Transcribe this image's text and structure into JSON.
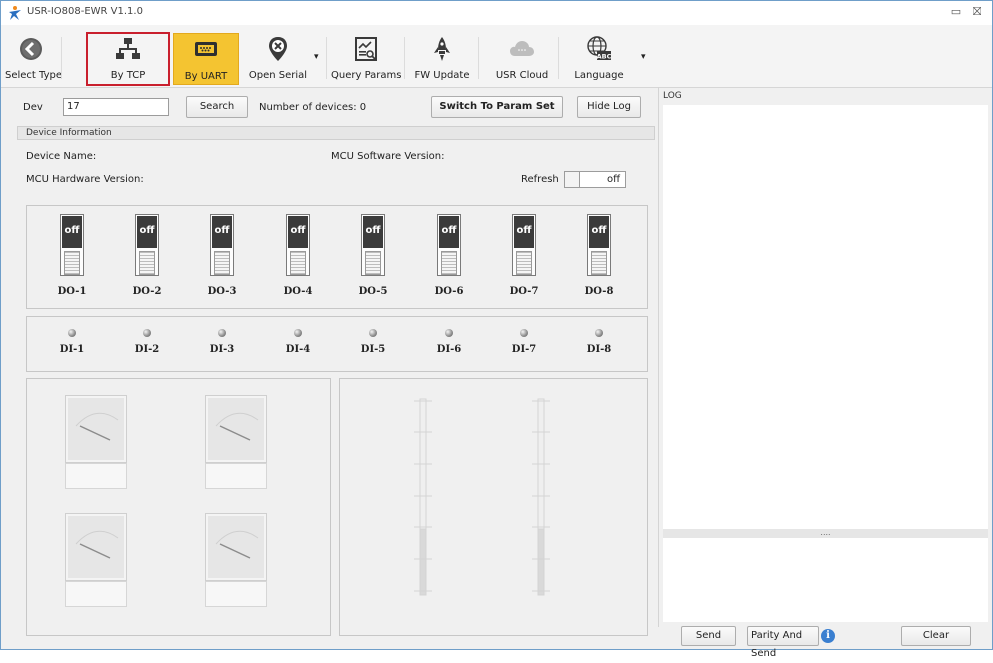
{
  "window": {
    "title": "USR-IO808-EWR V1.1.0",
    "minimize": "▭",
    "close": "⛝"
  },
  "toolbar": {
    "items": [
      {
        "label": "Select Type",
        "icon": "back-arrow-icon"
      },
      {
        "label": "By TCP",
        "icon": "network-icon"
      },
      {
        "label": "By UART",
        "icon": "serial-port-icon"
      },
      {
        "label": "Open Serial",
        "icon": "close-circle-pin-icon"
      },
      {
        "label": "Query Params",
        "icon": "query-params-icon"
      },
      {
        "label": "FW Update",
        "icon": "rocket-icon"
      },
      {
        "label": "USR Cloud",
        "icon": "cloud-icon"
      },
      {
        "label": "Language",
        "icon": "globe-abc-icon"
      }
    ],
    "active_item": "By UART",
    "highlighted_item": "By TCP",
    "active_color": "#f4c431",
    "highlight_color": "#c91f2d"
  },
  "search_row": {
    "dev_label": "Dev",
    "dev_value": "17",
    "search_button": "Search",
    "device_count": "Number of devices: 0",
    "switch_button": "Switch To Param Set",
    "hide_log_button": "Hide Log"
  },
  "device_info": {
    "header": "Device Information",
    "device_name_label": "Device Name:",
    "mcu_sw_label": "MCU Software Version:",
    "mcu_hw_label": "MCU Hardware Version:",
    "refresh_label": "Refresh",
    "refresh_state": "off"
  },
  "digital_outputs": [
    {
      "label": "DO-1",
      "state": "off"
    },
    {
      "label": "DO-2",
      "state": "off"
    },
    {
      "label": "DO-3",
      "state": "off"
    },
    {
      "label": "DO-4",
      "state": "off"
    },
    {
      "label": "DO-5",
      "state": "off"
    },
    {
      "label": "DO-6",
      "state": "off"
    },
    {
      "label": "DO-7",
      "state": "off"
    },
    {
      "label": "DO-8",
      "state": "off"
    }
  ],
  "digital_inputs": [
    "DI-1",
    "DI-2",
    "DI-3",
    "DI-4",
    "DI-5",
    "DI-6",
    "DI-7",
    "DI-8"
  ],
  "log": {
    "title": "LOG",
    "divider": "....",
    "send_button": "Send",
    "parity_send_button": "Parity And Send",
    "clear_button": "Clear"
  }
}
